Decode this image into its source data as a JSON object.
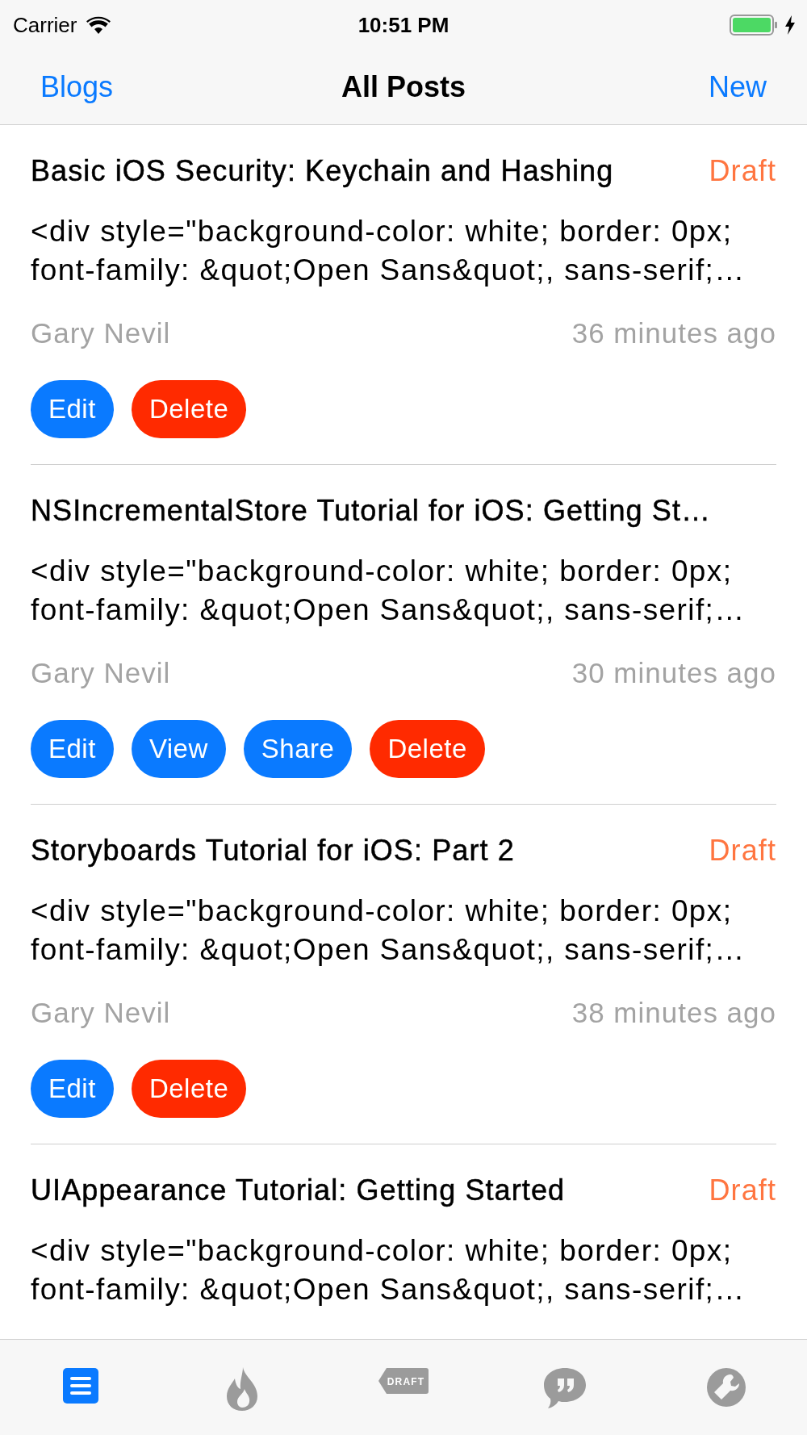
{
  "status_bar": {
    "carrier": "Carrier",
    "time": "10:51 PM"
  },
  "nav": {
    "left": "Blogs",
    "title": "All Posts",
    "right": "New"
  },
  "posts": [
    {
      "title": "Basic iOS Security: Keychain and Hashing",
      "status": "Draft",
      "body_lines": [
        "<div style=\"background-color: white; border: 0px;",
        "font-family: &quot;Open Sans&quot;, sans-serif;…"
      ],
      "author": "Gary Nevil",
      "time": "36 minutes ago",
      "actions": [
        {
          "kind": "edit",
          "label": "Edit"
        },
        {
          "kind": "delete",
          "label": "Delete"
        }
      ]
    },
    {
      "title": "NSIncrementalStore Tutorial for iOS: Getting St…",
      "body_lines": [
        "<div style=\"background-color: white; border: 0px;",
        "font-family: &quot;Open Sans&quot;, sans-serif;…"
      ],
      "author": "Gary Nevil",
      "time": "30 minutes ago",
      "actions": [
        {
          "kind": "edit",
          "label": "Edit"
        },
        {
          "kind": "view",
          "label": "View"
        },
        {
          "kind": "share",
          "label": "Share"
        },
        {
          "kind": "delete",
          "label": "Delete"
        }
      ]
    },
    {
      "title": "Storyboards Tutorial for iOS: Part 2",
      "status": "Draft",
      "body_lines": [
        "<div style=\"background-color: white; border: 0px;",
        "font-family: &quot;Open Sans&quot;, sans-serif;…"
      ],
      "author": "Gary Nevil",
      "time": "38 minutes ago",
      "actions": [
        {
          "kind": "edit",
          "label": "Edit"
        },
        {
          "kind": "delete",
          "label": "Delete"
        }
      ]
    },
    {
      "title": "UIAppearance Tutorial: Getting Started",
      "status": "Draft",
      "body_lines": [
        "<div style=\"background-color: white; border: 0px;",
        "font-family: &quot;Open Sans&quot;, sans-serif;…"
      ]
    }
  ],
  "tabs": [
    {
      "kind": "posts",
      "selected": true
    },
    {
      "kind": "trending",
      "selected": false
    },
    {
      "kind": "drafts",
      "selected": false,
      "icon_text": "DRAFT"
    },
    {
      "kind": "comments",
      "selected": false
    },
    {
      "kind": "settings",
      "selected": false
    }
  ]
}
